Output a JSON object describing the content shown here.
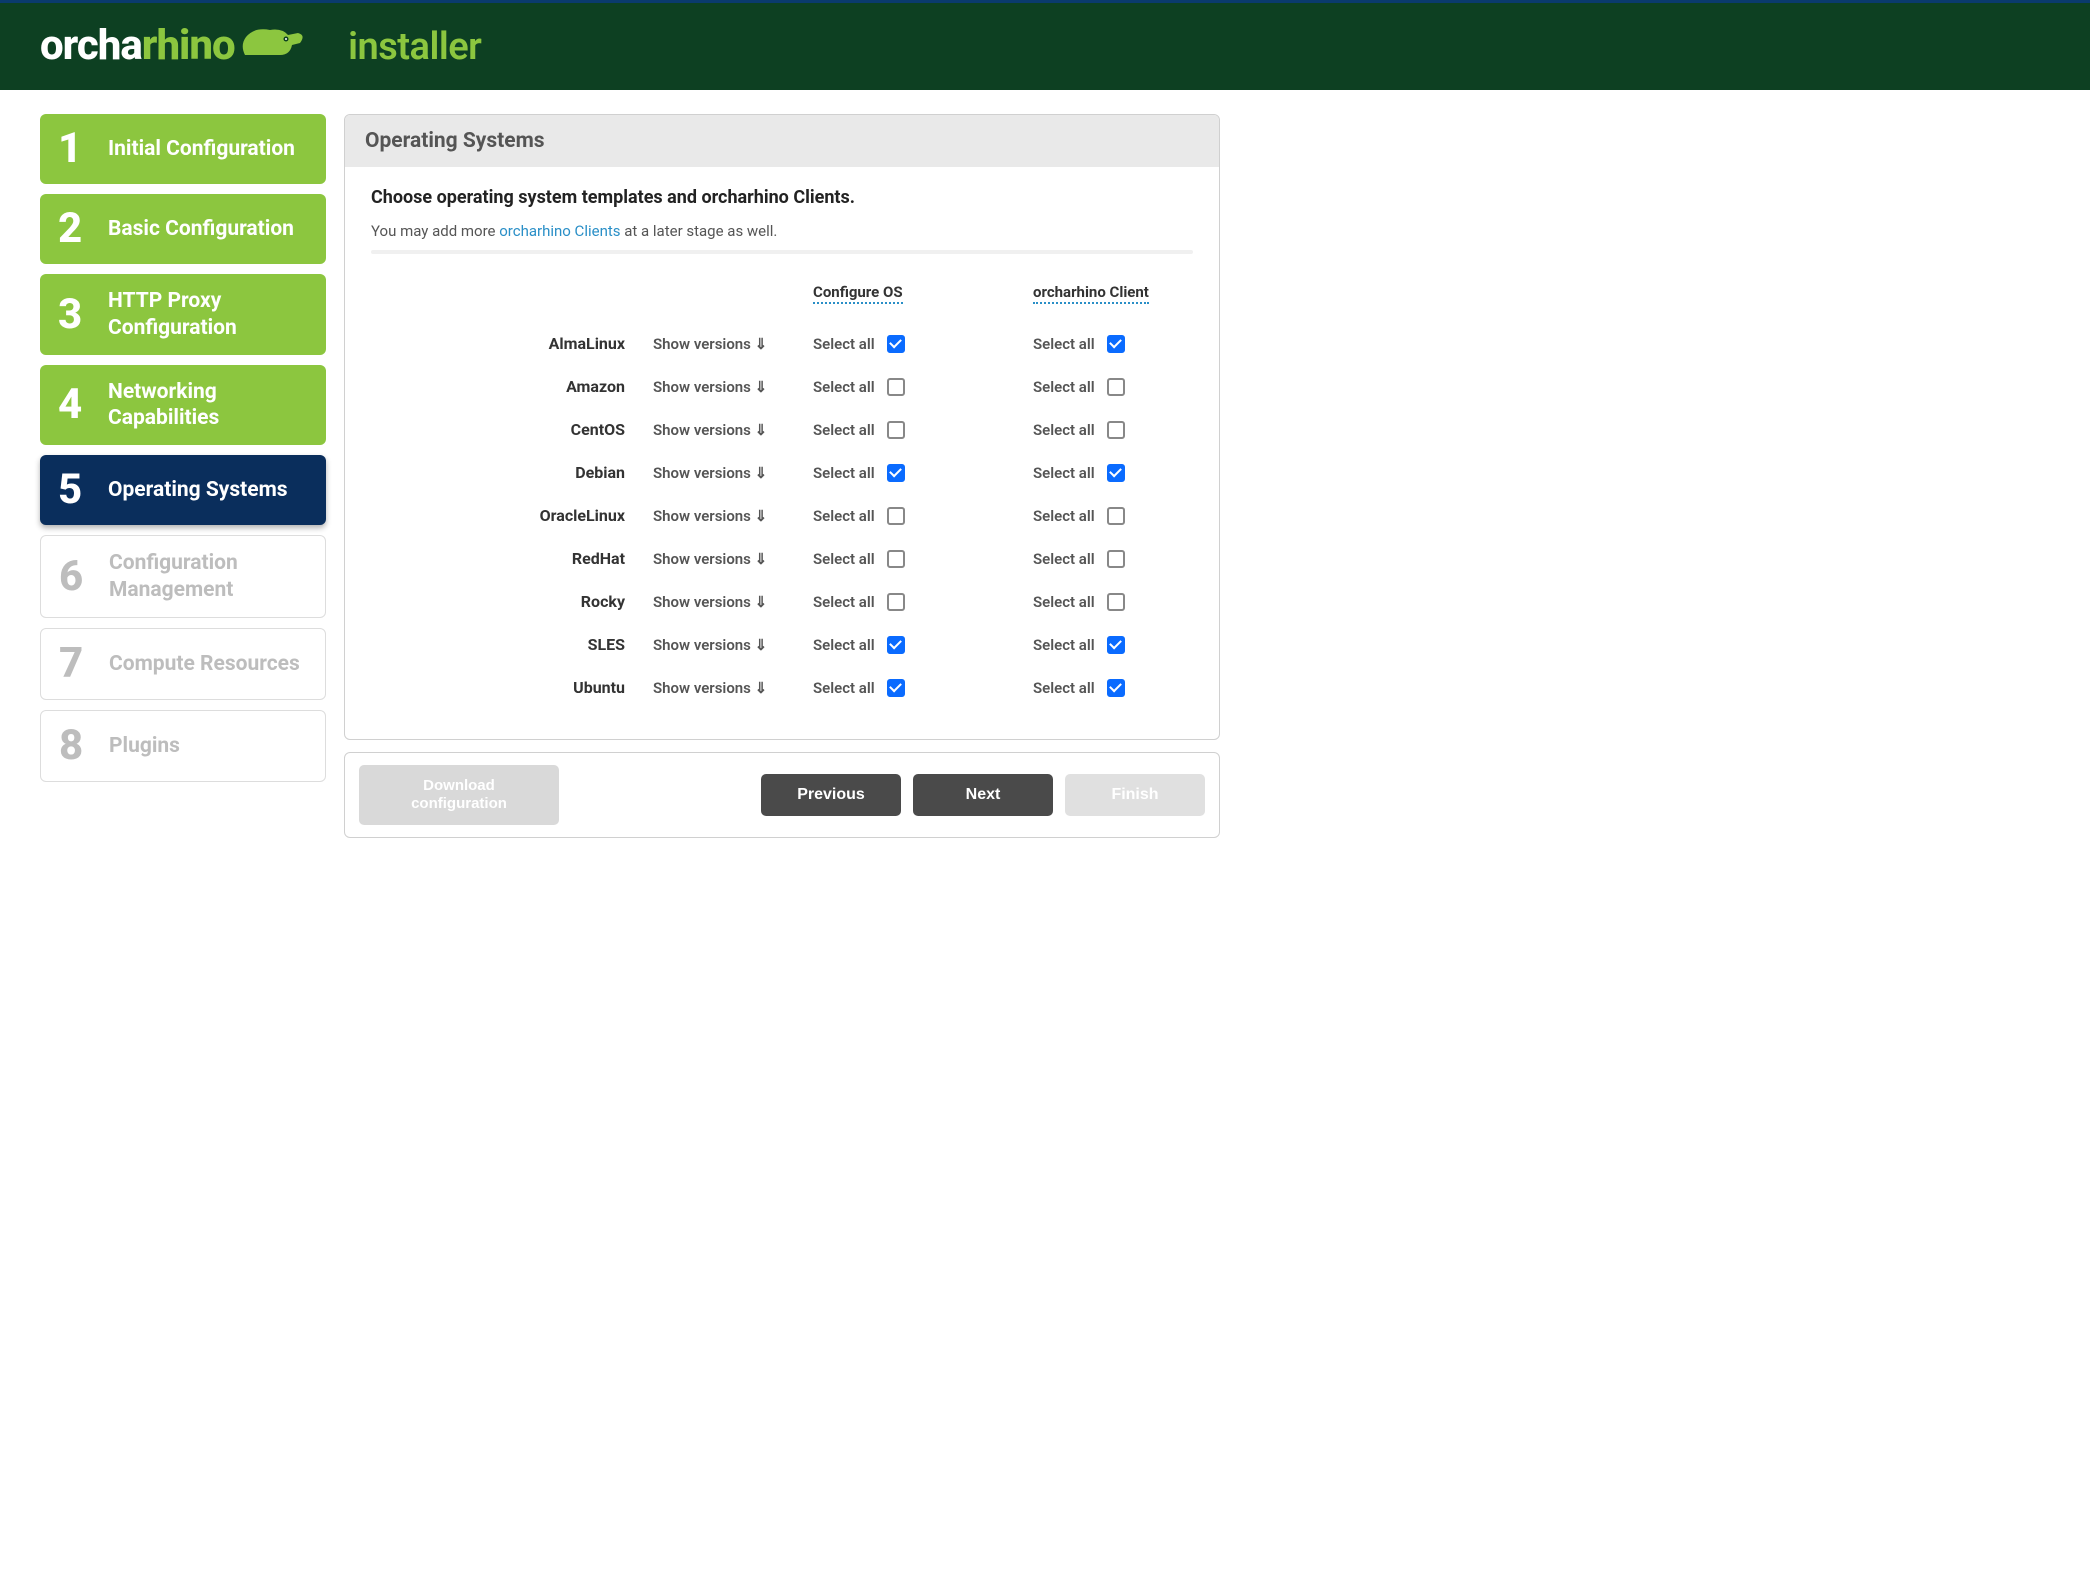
{
  "header": {
    "logo_part1": "orcha",
    "logo_part2": "rhino",
    "installer_label": "installer"
  },
  "steps": [
    {
      "num": "1",
      "label": "Initial Configuration",
      "state": "done"
    },
    {
      "num": "2",
      "label": "Basic Configuration",
      "state": "done"
    },
    {
      "num": "3",
      "label": "HTTP Proxy Configuration",
      "state": "done"
    },
    {
      "num": "4",
      "label": "Networking Capabilities",
      "state": "done"
    },
    {
      "num": "5",
      "label": "Operating Systems",
      "state": "active"
    },
    {
      "num": "6",
      "label": "Configuration Management",
      "state": "future"
    },
    {
      "num": "7",
      "label": "Compute Resources",
      "state": "future"
    },
    {
      "num": "8",
      "label": "Plugins",
      "state": "future"
    }
  ],
  "panel": {
    "title": "Operating Systems",
    "instruction": "Choose operating system templates and orcharhino Clients.",
    "subtext_before": "You may add more ",
    "subtext_link": "orcharhino Clients",
    "subtext_after": " at a later stage as well.",
    "col_configure": "Configure OS",
    "col_client": "orcharhino Client",
    "show_versions_label": "Show versions ⇓",
    "select_all_label": "Select all",
    "rows": [
      {
        "name": "AlmaLinux",
        "configure_checked": true,
        "client_checked": true
      },
      {
        "name": "Amazon",
        "configure_checked": false,
        "client_checked": false
      },
      {
        "name": "CentOS",
        "configure_checked": false,
        "client_checked": false
      },
      {
        "name": "Debian",
        "configure_checked": true,
        "client_checked": true
      },
      {
        "name": "OracleLinux",
        "configure_checked": false,
        "client_checked": false
      },
      {
        "name": "RedHat",
        "configure_checked": false,
        "client_checked": false
      },
      {
        "name": "Rocky",
        "configure_checked": false,
        "client_checked": false
      },
      {
        "name": "SLES",
        "configure_checked": true,
        "client_checked": true
      },
      {
        "name": "Ubuntu",
        "configure_checked": true,
        "client_checked": true
      }
    ]
  },
  "footer": {
    "download_line1": "Download",
    "download_line2": "configuration",
    "previous": "Previous",
    "next": "Next",
    "finish": "Finish"
  }
}
